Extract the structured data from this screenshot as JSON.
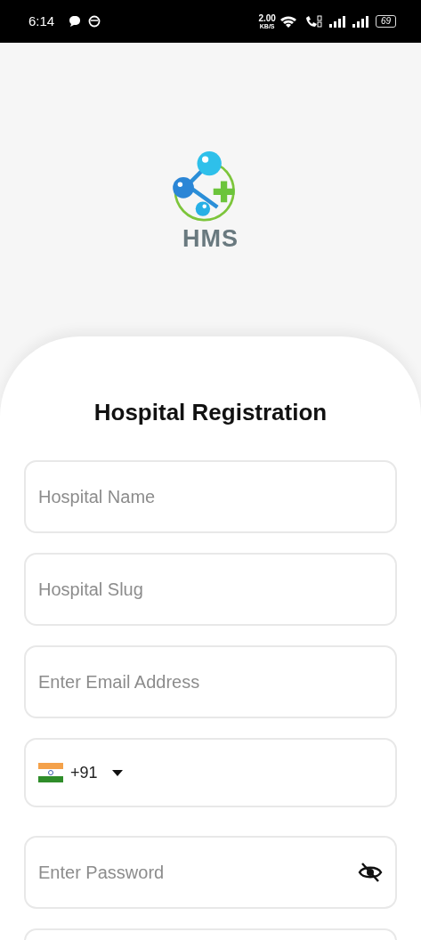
{
  "status_bar": {
    "time": "6:14",
    "speed": "2.00",
    "speed_unit": "KB/S",
    "battery": "69"
  },
  "logo": {
    "text": "HMS"
  },
  "title": "Hospital Registration",
  "fields": [
    {
      "kind": "text",
      "placeholder": "Hospital Name"
    },
    {
      "kind": "text",
      "placeholder": "Hospital Slug"
    },
    {
      "kind": "text",
      "placeholder": "Enter Email Address"
    },
    {
      "kind": "phone",
      "code": "+91"
    },
    {
      "kind": "password",
      "placeholder": "Enter Password",
      "masked": true
    },
    {
      "kind": "text"
    }
  ]
}
